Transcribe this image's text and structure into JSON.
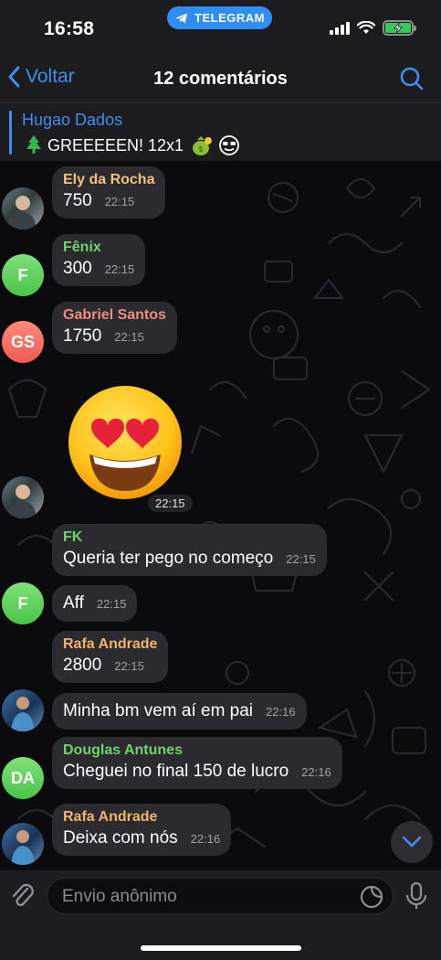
{
  "status_bar": {
    "time": "16:58",
    "app_pill": "TELEGRAM"
  },
  "header": {
    "back_label": "Voltar",
    "title": "12 comentários"
  },
  "pinned": {
    "author": "Hugao Dados",
    "text": "GREEEEEN! 12x1"
  },
  "messages": [
    {
      "author": "Ely da Rocha",
      "author_color": "#f2c37a",
      "text": "750",
      "time": "22:15",
      "avatar": "photo"
    },
    {
      "author": "Fênix",
      "author_color": "#6fd36b",
      "text": "300",
      "time": "22:15",
      "avatar_initials": "F"
    },
    {
      "author": "Gabriel Santos",
      "author_color": "#f28b82",
      "text": "1750",
      "time": "22:15",
      "avatar_initials": "GS"
    },
    {
      "sticker": "heart-eyes-emoji",
      "time": "22:15",
      "avatar": "photo"
    },
    {
      "author": "FK",
      "author_color": "#6fd36b",
      "text": "Queria ter pego no começo",
      "time": "22:15"
    },
    {
      "text": "Aff",
      "time": "22:15",
      "avatar_initials": "F"
    },
    {
      "author": "Rafa Andrade",
      "author_color": "#f2b36a",
      "text": "2800",
      "time": "22:15"
    },
    {
      "text": "Minha bm vem aí em pai",
      "time": "22:16",
      "avatar": "photo"
    },
    {
      "author": "Douglas Antunes",
      "author_color": "#6fd36b",
      "text": "Cheguei no final 150 de lucro",
      "time": "22:16",
      "avatar_initials": "DA"
    },
    {
      "author": "Rafa Andrade",
      "author_color": "#f2b36a",
      "text": "Deixa com nós",
      "time": "22:16",
      "avatar": "photo"
    }
  ],
  "composer": {
    "placeholder": "Envio anônimo"
  },
  "colors": {
    "accent": "#3e8ff3",
    "bubble": "#2a2a2f",
    "background": "#0b0b0d"
  }
}
